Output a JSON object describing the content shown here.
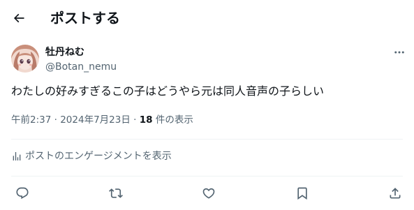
{
  "header": {
    "title": "ポストする",
    "back_icon": "arrow-left-icon"
  },
  "author": {
    "display_name": "牡丹ねむ",
    "handle": "@Botan_nemu",
    "avatar": "anime-girl-avatar"
  },
  "post": {
    "text": "わたしの好みすぎるこの子はどうやら元は同人音声の子らしい",
    "time": "午前2:37",
    "separator": "·",
    "date": "2024年7月23日",
    "views_count": "18",
    "views_label": "件の表示"
  },
  "engagements": {
    "label": "ポストのエンゲージメントを表示",
    "icon": "bar-chart-icon"
  },
  "actions": [
    {
      "name": "reply",
      "icon": "reply-icon"
    },
    {
      "name": "repost",
      "icon": "repost-icon"
    },
    {
      "name": "like",
      "icon": "heart-icon"
    },
    {
      "name": "bookmark",
      "icon": "bookmark-icon"
    },
    {
      "name": "share",
      "icon": "share-icon"
    }
  ],
  "colors": {
    "text": "#0f1419",
    "secondary": "#536471",
    "divider": "#eff3f4",
    "background": "#ffffff"
  }
}
